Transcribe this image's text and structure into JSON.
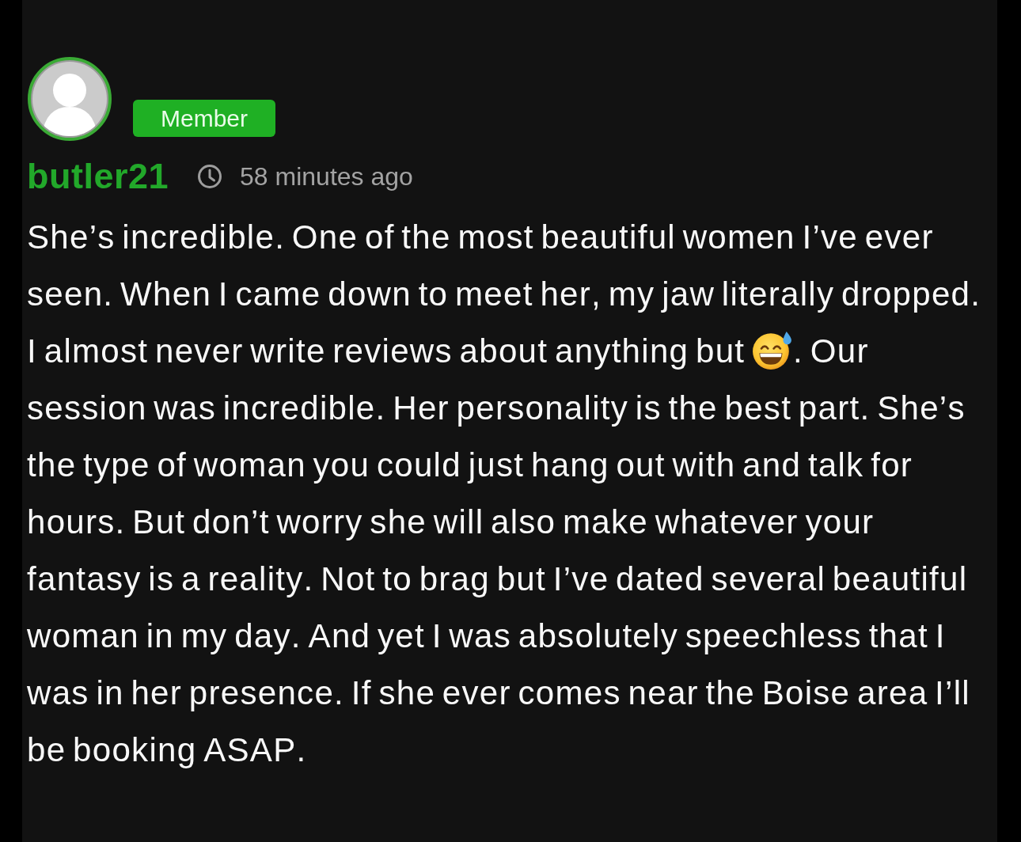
{
  "post": {
    "author": {
      "username": "butler21",
      "role": "Member"
    },
    "time": "58 minutes ago",
    "body": [
      {
        "kind": "text",
        "text": "She’s incredible. One of the most beautiful women I’ve ever seen. When I came down to meet her, my jaw literally dropped. I almost never write reviews about anything but "
      },
      {
        "kind": "emoji"
      },
      {
        "kind": "text",
        "text": ". Our session was incredible. Her personality is the best part. She’s the type of woman you could just hang out with and talk for hours. But don’t worry she will also make whatever your fantasy is a reality. Not to brag but I’ve dated several beautiful woman in my day. And yet I was absolutely speechless that I was in her presence. If she ever comes near the Boise area I’ll be booking ASAP."
      }
    ]
  }
}
